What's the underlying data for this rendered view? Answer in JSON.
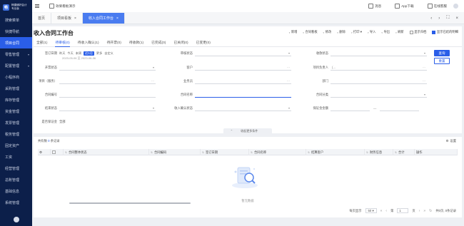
{
  "app": {
    "logo_line1": "畅捷通好会计",
    "logo_line2": "专业版"
  },
  "sidebar": {
    "items": [
      {
        "label": "搜索菜单",
        "caret": ""
      },
      {
        "label": "快捷导航",
        "caret": ""
      },
      {
        "label": "项目合同",
        "caret": "",
        "active": true
      },
      {
        "label": "零售管理",
        "caret": "▾"
      },
      {
        "label": "配置管理",
        "caret": "▾"
      },
      {
        "label": "小程序商",
        "caret": ""
      },
      {
        "label": "采购管理",
        "caret": ""
      },
      {
        "label": "库存管理",
        "caret": ""
      },
      {
        "label": "资金管理",
        "caret": ""
      },
      {
        "label": "发票管理",
        "caret": ""
      },
      {
        "label": "税务管理",
        "caret": ""
      },
      {
        "label": "固定资产",
        "caret": ""
      },
      {
        "label": "工资",
        "caret": ""
      },
      {
        "label": "经营管理",
        "caret": ""
      },
      {
        "label": "总账管理",
        "caret": ""
      },
      {
        "label": "基础信息",
        "caret": ""
      },
      {
        "label": "系统管理",
        "caret": ""
      }
    ]
  },
  "topbar": {
    "demo_label": "效果看板演示",
    "right": [
      {
        "label": "消息"
      },
      {
        "label": "App下载"
      },
      {
        "label": "在线客服"
      }
    ]
  },
  "page_tabs": [
    {
      "label": "首页",
      "closable": false
    },
    {
      "label": "项目看板",
      "closable": true
    },
    {
      "label": "收入合同工作台",
      "closable": true,
      "active": true
    }
  ],
  "main": {
    "title": "收入合同工作台",
    "toolbar": [
      {
        "label": "新增"
      },
      {
        "label": "合同看板"
      },
      {
        "label": "修改"
      },
      {
        "label": "删除"
      },
      {
        "label": "打印 ▾"
      },
      {
        "label": "导入"
      },
      {
        "label": "导出"
      },
      {
        "label": "刷新"
      },
      {
        "label": "显示归档"
      },
      {
        "label": "显示已结的明细"
      }
    ],
    "status_tabs": [
      {
        "label": "全部(1)"
      },
      {
        "label": "待审核(0)",
        "active": true
      },
      {
        "label": "待收入确认(1)"
      },
      {
        "label": "待开票(0)"
      },
      {
        "label": "待收款(1)"
      },
      {
        "label": "已完成(0)"
      },
      {
        "label": "已关闭(0)"
      },
      {
        "label": "已变更(0)"
      }
    ],
    "filters": {
      "sign_date_label": "签订日期",
      "sign_date_chips": [
        "昨天",
        "今天",
        "本周",
        "近1月",
        "更多",
        "自定义"
      ],
      "sign_date_active": "近1月",
      "sign_date_range": "2023-05-06 至 2023-06-06",
      "approval_status_label": "审核状态",
      "collect_status_label": "收款状态",
      "invoice_status_label": "开票状态",
      "customer_label": "客户",
      "project_manager_label": "项目负责人",
      "project_manager_value": "(...",
      "project_label": "项目（服务）",
      "salesman_label": "业务员",
      "dept_label": "部门",
      "contract_no_label": "合同编号",
      "contract_name_label": "合同名称",
      "contract_type_label": "合同分类",
      "close_status_label": "结束状态",
      "income_confirm_label": "收入确认状态",
      "guarantee_amount_label": "保证金金额",
      "guarantee_dash": "—",
      "has_guarantee_label": "是否保证金",
      "has_guarantee_value": "全部",
      "query_button": "查询",
      "reset_button": "重置",
      "collapse_label": "收起更多条件"
    }
  },
  "table": {
    "info_prefix": "共有数",
    "info_count": "0",
    "info_suffix": "条记录",
    "settings_label": "设置",
    "columns": [
      {
        "label": "⚙"
      },
      {
        "label": ""
      },
      {
        "label": "合同整体状态"
      },
      {
        "label": "合同编码"
      },
      {
        "label": "签订日期"
      },
      {
        "label": "合同名称"
      },
      {
        "label": "结算客户"
      },
      {
        "label": "财务信息"
      },
      {
        "label": "合计"
      },
      {
        "label": "操作"
      }
    ],
    "empty_text": "暂无数据",
    "pager": {
      "page_size_label": "每页显示",
      "page_size": "50",
      "goto_label": "第",
      "page_no": "1",
      "page_unit": "页",
      "summary": "共0页, 0条记录"
    }
  },
  "colors": {
    "sidebar_bg": "#0c1f4a",
    "accent": "#2a5ee8"
  }
}
